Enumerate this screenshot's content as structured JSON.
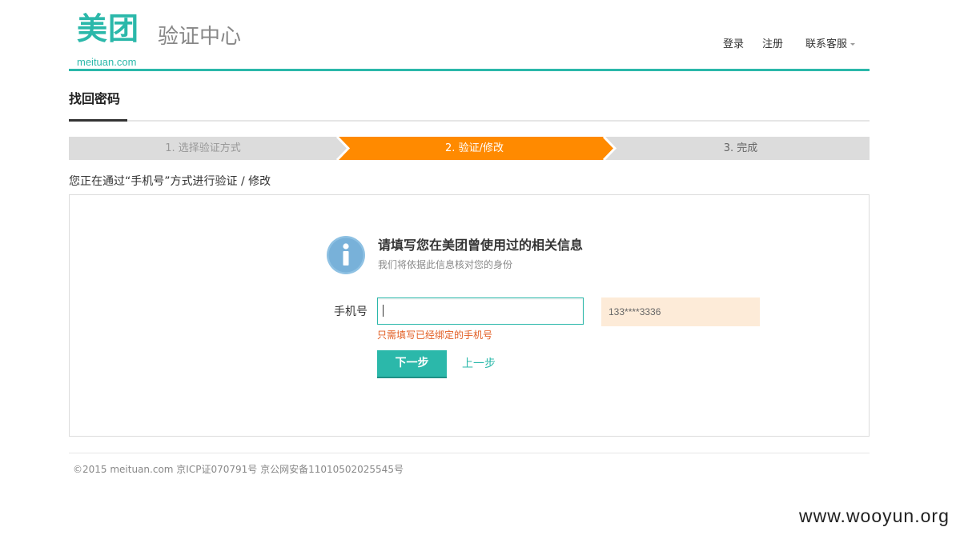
{
  "header": {
    "logo_cn": "美团",
    "logo_en": "meituan.com",
    "site_title": "验证中心",
    "nav": {
      "login": "登录",
      "register": "注册",
      "support": "联系客服"
    }
  },
  "page": {
    "title": "找回密码"
  },
  "steps": {
    "items": [
      {
        "label": "1. 选择验证方式",
        "state": "done"
      },
      {
        "label": "2. 验证/修改",
        "state": "active"
      },
      {
        "label": "3. 完成",
        "state": "pending"
      }
    ],
    "colors": {
      "active": "#ff8a00",
      "inactive": "#dcdcdc"
    }
  },
  "verify_hint": "您正在通过“手机号”方式进行验证 / 修改",
  "card": {
    "icon": "info-icon",
    "title": "请填写您在美团曾使用过的相关信息",
    "subtitle": "我们将依据此信息核对您的身份",
    "phone_label": "手机号",
    "phone_value": "",
    "masked_phone": "133****3336",
    "phone_error": "只需填写已经绑定的手机号",
    "next_label": "下一步",
    "prev_label": "上一步"
  },
  "footer": {
    "text": "©2015 meituan.com 京ICP证070791号 京公网安备11010502025545号"
  },
  "watermark": "www.wooyun.org",
  "theme": {
    "brand": "#2bb8aa",
    "accent": "#ff8a00",
    "error": "#e25d22"
  }
}
